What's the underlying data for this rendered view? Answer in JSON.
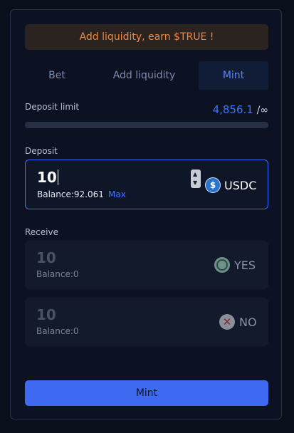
{
  "banner": {
    "text": "Add liquidity, earn $TRUE !"
  },
  "tabs": [
    {
      "label": "Bet"
    },
    {
      "label": "Add liquidity"
    },
    {
      "label": "Mint",
      "active": true
    }
  ],
  "deposit_limit": {
    "label": "Deposit limit",
    "value": "4,856.1",
    "separator": "/",
    "max": "∞",
    "progress_fraction": 0
  },
  "deposit": {
    "label": "Deposit",
    "amount": "10",
    "balance": "Balance:92.061",
    "max_label": "Max",
    "token": "USDC",
    "token_icon": "usdc-icon"
  },
  "receive": {
    "label": "Receive",
    "items": [
      {
        "amount": "10",
        "balance": "Balance:0",
        "token": "YES",
        "icon": "yes-token-icon"
      },
      {
        "amount": "10",
        "balance": "Balance:0",
        "token": "NO",
        "icon": "no-token-icon"
      }
    ]
  },
  "submit": {
    "label": "Mint"
  },
  "colors": {
    "accent": "#3d76f2",
    "banner_text": "#f0883e",
    "background": "#0a0f1c"
  }
}
